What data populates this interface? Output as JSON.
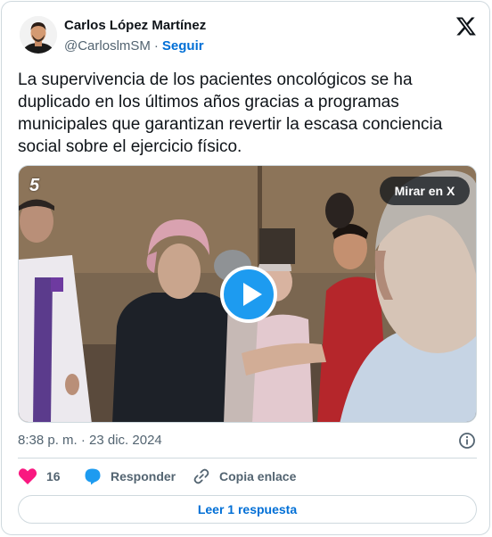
{
  "author": {
    "name": "Carlos López Martínez",
    "handle": "@CarloslmSM",
    "separator": "·",
    "follow_label": "Seguir"
  },
  "tweet": {
    "text": "La supervivencia de los pacientes oncológicos se ha duplicado en los últimos años gracias a programas municipales que garantizan revertir la escasa conciencia social sobre el ejercicio físico."
  },
  "media": {
    "channel_logo": "5",
    "watch_label": "Mirar en X"
  },
  "meta": {
    "timestamp": "8:38 p. m. · 23 dic. 2024"
  },
  "actions": {
    "like_count": "16",
    "reply_label": "Responder",
    "copy_label": "Copia enlace"
  },
  "read_replies_label": "Leer 1 respuesta",
  "colors": {
    "accent": "#1d9bf0",
    "link": "#006fd6",
    "like": "#f91880",
    "muted": "#536471",
    "border": "#cfd9de"
  },
  "icons": [
    "x-logo-icon",
    "play-icon",
    "info-icon",
    "heart-icon",
    "reply-bubble-icon",
    "link-icon"
  ]
}
